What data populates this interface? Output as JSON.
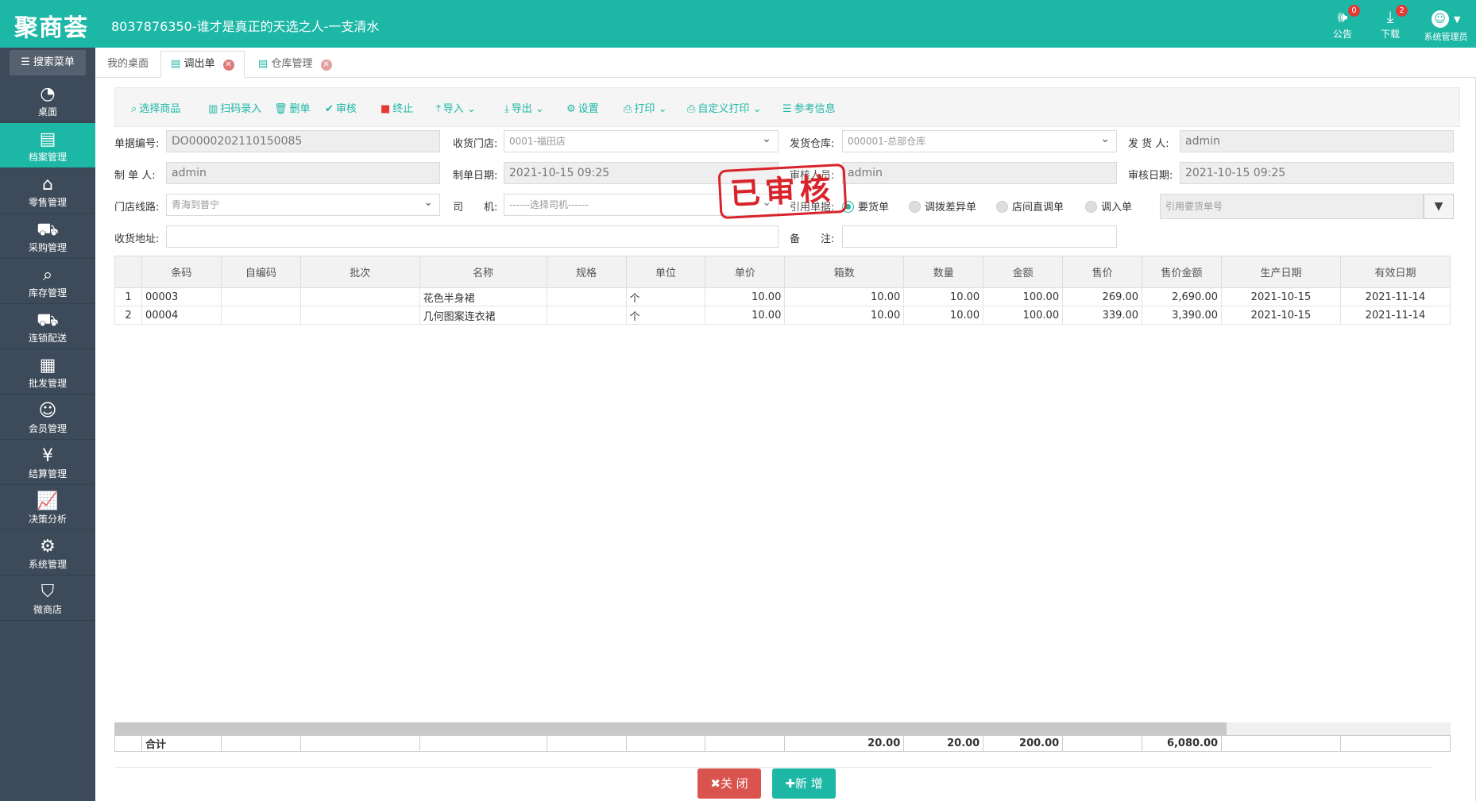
{
  "header": {
    "logo": "聚商荟",
    "title": "8037876350-谁才是真正的天选之人-一支清水",
    "notice_label": "公告",
    "notice_count": "0",
    "download_label": "下载",
    "download_count": "2",
    "user_label": "系统管理员"
  },
  "sidebar": {
    "search_label": "搜索菜单",
    "items": [
      {
        "label": "桌面",
        "icon": "dashboard-icon"
      },
      {
        "label": "档案管理",
        "icon": "archive-icon"
      },
      {
        "label": "零售管理",
        "icon": "store-icon"
      },
      {
        "label": "采购管理",
        "icon": "cart-icon"
      },
      {
        "label": "库存管理",
        "icon": "inventory-search-icon"
      },
      {
        "label": "连锁配送",
        "icon": "truck-icon"
      },
      {
        "label": "批发管理",
        "icon": "wholesale-icon"
      },
      {
        "label": "会员管理",
        "icon": "member-icon"
      },
      {
        "label": "结算管理",
        "icon": "yen-icon"
      },
      {
        "label": "决策分析",
        "icon": "chart-icon"
      },
      {
        "label": "系统管理",
        "icon": "gear-icon"
      },
      {
        "label": "微商店",
        "icon": "bag-icon"
      }
    ]
  },
  "tabs": [
    {
      "label": "我的桌面"
    },
    {
      "label": "调出单"
    },
    {
      "label": "仓库管理"
    }
  ],
  "toolbar": {
    "select_goods": "选择商品",
    "scan_input": "扫码录入",
    "delete": "删单",
    "audit": "审核",
    "terminate": "终止",
    "import": "导入",
    "export": "导出",
    "settings": "设置",
    "print": "打印",
    "custom_print": "自定义打印",
    "reference_info": "参考信息"
  },
  "form": {
    "doc_no_label": "单据编号:",
    "doc_no": "DO0000202110150085",
    "recv_store_label": "收货门店:",
    "recv_store": "0001-福田店",
    "ship_wh_label": "发货仓库:",
    "ship_wh": "000001-总部仓库",
    "shipper_label": "发 货 人:",
    "shipper": "admin",
    "maker_label": "制 单 人:",
    "maker": "admin",
    "make_date_label": "制单日期:",
    "make_date": "2021-10-15 09:25",
    "auditor_label": "审核人员:",
    "auditor": "admin",
    "audit_date_label": "审核日期:",
    "audit_date": "2021-10-15 09:25",
    "route_label": "门店线路:",
    "route": "青海到普宁",
    "driver_label": "司　　机:",
    "driver_placeholder": "------选择司机------",
    "ref_label": "引用单据:",
    "ref_options": [
      "要货单",
      "调拨差异单",
      "店间直调单",
      "调入单"
    ],
    "ref_no_placeholder": "引用要货单号",
    "address_label": "收货地址:",
    "address": "",
    "remark_label": "备　　注:",
    "remark": ""
  },
  "stamp": "已审核",
  "table": {
    "headers": [
      "",
      "条码",
      "自编码",
      "批次",
      "名称",
      "规格",
      "单位",
      "单价",
      "箱数",
      "数量",
      "金额",
      "售价",
      "售价金额",
      "生产日期",
      "有效日期"
    ],
    "rows": [
      [
        "1",
        "00003",
        "",
        "",
        "花色半身裙",
        "",
        "个",
        "10.00",
        "10.00",
        "10.00",
        "100.00",
        "269.00",
        "2,690.00",
        "2021-10-15",
        "2021-11-14"
      ],
      [
        "2",
        "00004",
        "",
        "",
        "几何图案连衣裙",
        "",
        "个",
        "10.00",
        "10.00",
        "10.00",
        "100.00",
        "339.00",
        "3,390.00",
        "2021-10-15",
        "2021-11-14"
      ]
    ],
    "footer": [
      "",
      "合计",
      "",
      "",
      "",
      "",
      "",
      "",
      "20.00",
      "20.00",
      "200.00",
      "",
      "6,080.00",
      "",
      ""
    ]
  },
  "buttons": {
    "close": "关 闭",
    "new": "新 增"
  }
}
